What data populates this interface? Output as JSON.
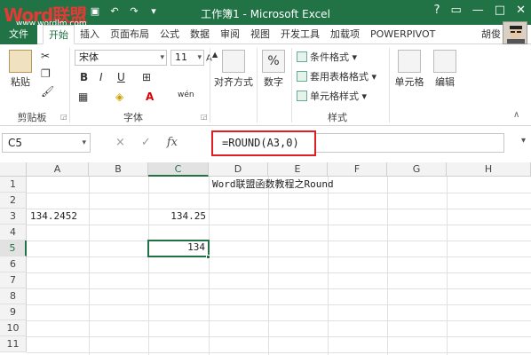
{
  "app": {
    "title": "工作簿1 - Microsoft Excel",
    "watermark_brand": "Word联盟",
    "watermark_url": "www.wordlm.com",
    "accent_color": "#217346"
  },
  "tabs": {
    "file": "文件",
    "items": [
      "开始",
      "插入",
      "页面布局",
      "公式",
      "数据",
      "审阅",
      "视图",
      "开发工具",
      "加载项",
      "POWERPIVOT"
    ],
    "active_index": 0,
    "user": "胡俊"
  },
  "ribbon": {
    "clipboard": {
      "paste": "粘贴",
      "label": "剪贴板"
    },
    "font": {
      "name": "宋体",
      "size": "11",
      "bold": "B",
      "italic": "I",
      "underline": "U",
      "font_color": "A",
      "label": "字体"
    },
    "alignment": {
      "label": "对齐方式"
    },
    "number": {
      "label": "数字",
      "icon_text": "%"
    },
    "styles": {
      "conditional": "条件格式",
      "table": "套用表格格式",
      "cell_styles": "单元格样式",
      "label": "样式"
    },
    "cells": {
      "label": "单元格"
    },
    "editing": {
      "label": "编辑"
    }
  },
  "formula_bar": {
    "name_box": "C5",
    "formula": "=ROUND(A3,0)",
    "fx": "fx",
    "cancel": "×",
    "enter": "✓"
  },
  "sheet": {
    "columns": [
      "A",
      "B",
      "C",
      "D",
      "E",
      "F",
      "G",
      "H"
    ],
    "selected_column": "C",
    "rows": [
      "1",
      "2",
      "3",
      "4",
      "5",
      "6",
      "7",
      "8",
      "9",
      "10",
      "11"
    ],
    "selected_row": "5",
    "cells": {
      "D1": "Word联盟函数教程之Round",
      "A3": "134.2452",
      "C3": "134.25",
      "C5": "134"
    }
  }
}
